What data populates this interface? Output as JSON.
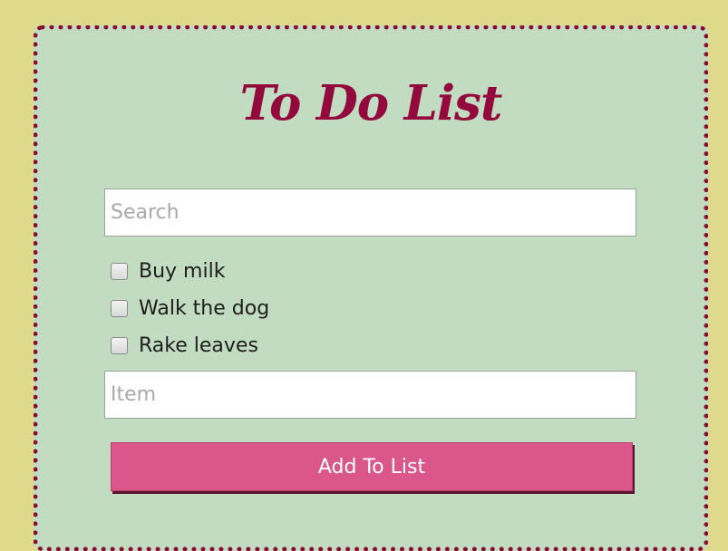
{
  "title": "To Do List",
  "search": {
    "placeholder": "Search",
    "value": ""
  },
  "items": [
    {
      "label": "Buy milk",
      "checked": false
    },
    {
      "label": "Walk the dog",
      "checked": false
    },
    {
      "label": "Rake leaves",
      "checked": false
    }
  ],
  "item_input": {
    "placeholder": "Item",
    "value": ""
  },
  "add_button": {
    "label": "Add To List"
  },
  "colors": {
    "page_background": "#dfd98b",
    "card_background": "#c1dcc1",
    "accent": "#94093d",
    "button": "#db568a"
  }
}
